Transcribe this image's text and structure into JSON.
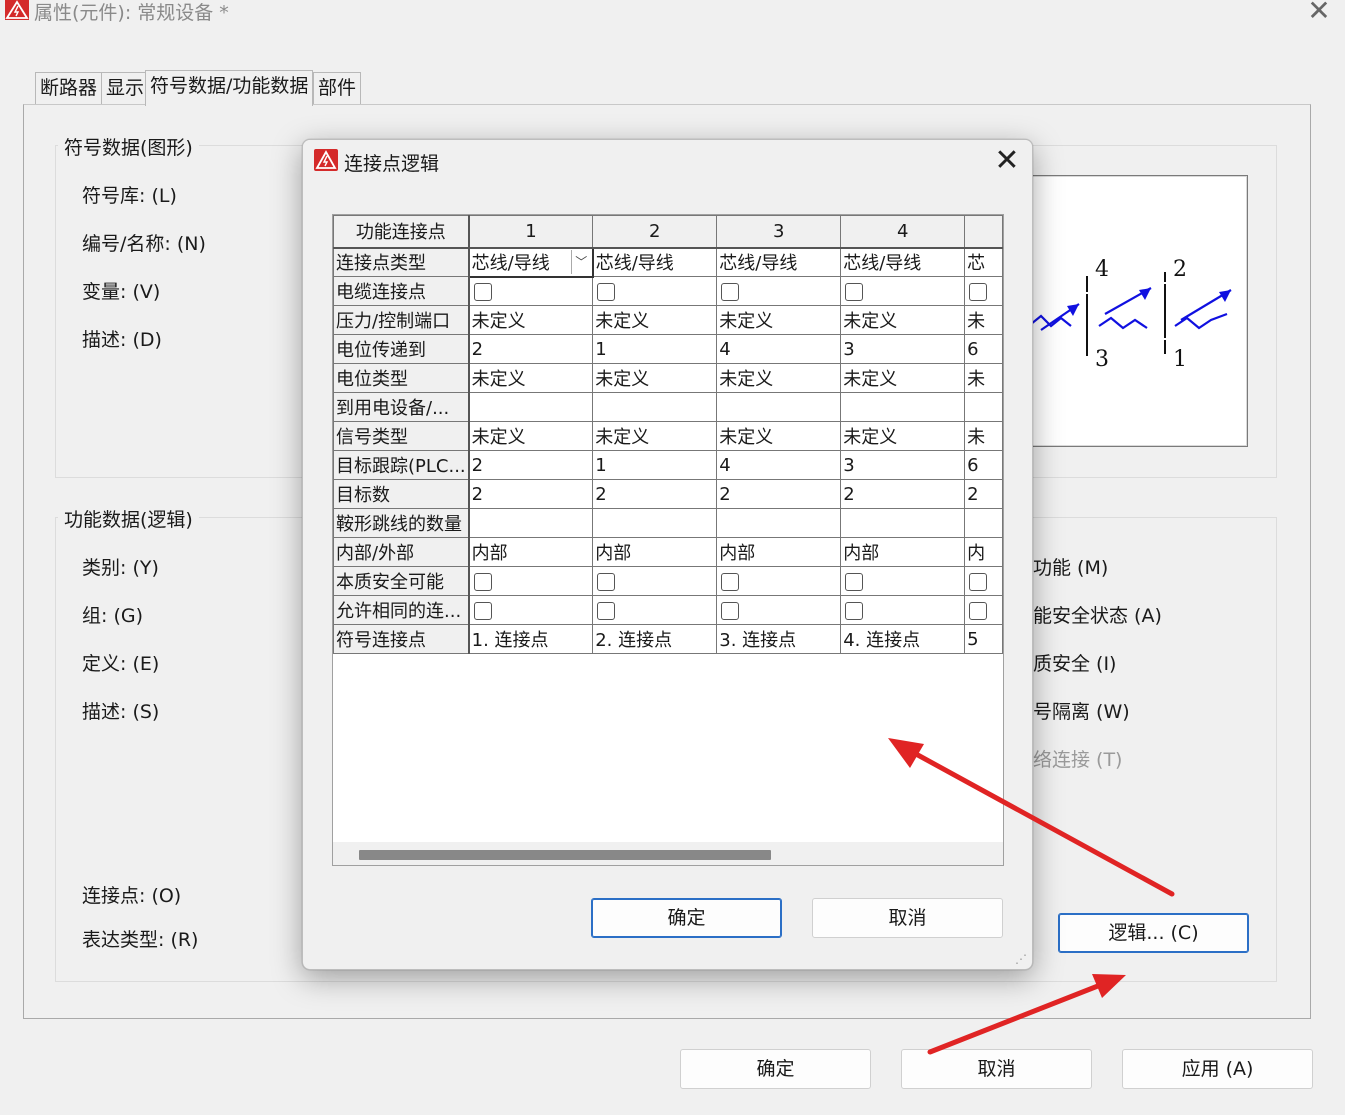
{
  "window": {
    "title": "属性(元件): 常规设备 *",
    "close_glyph": "✕"
  },
  "tabs": [
    "断路器",
    "显示",
    "符号数据/功能数据",
    "部件"
  ],
  "active_tab": 2,
  "symbol_group": {
    "title": "符号数据(图形)",
    "labels": [
      "符号库: (L)",
      "编号/名称: (N)",
      "变量: (V)",
      "描述: (D)"
    ]
  },
  "function_group": {
    "title": "功能数据(逻辑)",
    "labels": [
      "类别: (Y)",
      "组: (G)",
      "定义: (E)",
      "描述: (S)"
    ],
    "right_labels": [
      "主功能 (M)",
      "功能安全状态 (A)",
      "本质安全 (I)",
      "信号隔离 (W)",
      "网络连接 (T)"
    ],
    "bottom_labels": [
      "连接点: (O)",
      "表达类型: (R)"
    ],
    "logic_button": "逻辑... (C)"
  },
  "preview": {
    "terminal_numbers": [
      "4",
      "2",
      "3",
      "1"
    ]
  },
  "footer": {
    "ok": "确定",
    "cancel": "取消",
    "apply": "应用 (A)"
  },
  "dialog": {
    "title": "连接点逻辑",
    "close_glyph": "✕",
    "corner_header": "功能连接点",
    "columns": [
      "1",
      "2",
      "3",
      "4",
      ""
    ],
    "rows": [
      {
        "label": "连接点类型",
        "kind": "text",
        "values": [
          "芯线/导线",
          "芯线/导线",
          "芯线/导线",
          "芯线/导线",
          "芯"
        ]
      },
      {
        "label": "电缆连接点",
        "kind": "check",
        "values": [
          "",
          "",
          "",
          "",
          ""
        ]
      },
      {
        "label": "压力/控制端口",
        "kind": "text",
        "values": [
          "未定义",
          "未定义",
          "未定义",
          "未定义",
          "未"
        ]
      },
      {
        "label": "电位传递到",
        "kind": "text",
        "values": [
          "2",
          "1",
          "4",
          "3",
          "6"
        ]
      },
      {
        "label": "电位类型",
        "kind": "text",
        "values": [
          "未定义",
          "未定义",
          "未定义",
          "未定义",
          "未"
        ]
      },
      {
        "label": "到用电设备/...",
        "kind": "text",
        "values": [
          "",
          "",
          "",
          "",
          ""
        ]
      },
      {
        "label": "信号类型",
        "kind": "text",
        "values": [
          "未定义",
          "未定义",
          "未定义",
          "未定义",
          "未"
        ]
      },
      {
        "label": "目标跟踪(PLC...",
        "kind": "text",
        "values": [
          "2",
          "1",
          "4",
          "3",
          "6"
        ]
      },
      {
        "label": "目标数",
        "kind": "text",
        "values": [
          "2",
          "2",
          "2",
          "2",
          "2"
        ]
      },
      {
        "label": "鞍形跳线的数量",
        "kind": "text",
        "values": [
          "",
          "",
          "",
          "",
          ""
        ]
      },
      {
        "label": "内部/外部",
        "kind": "text",
        "values": [
          "内部",
          "内部",
          "内部",
          "内部",
          "内"
        ]
      },
      {
        "label": "本质安全可能",
        "kind": "check",
        "values": [
          "",
          "",
          "",
          "",
          ""
        ]
      },
      {
        "label": "允许相同的连...",
        "kind": "check",
        "values": [
          "",
          "",
          "",
          "",
          ""
        ]
      },
      {
        "label": "符号连接点",
        "kind": "text",
        "values": [
          "1. 连接点",
          "2. 连接点",
          "3. 连接点",
          "4. 连接点",
          "5"
        ]
      }
    ],
    "ok": "确定",
    "cancel": "取消"
  },
  "colors": {
    "annotation_arrow": "#e02424",
    "symbol_blue": "#1010e0",
    "app_icon_red": "#d42a2a"
  }
}
